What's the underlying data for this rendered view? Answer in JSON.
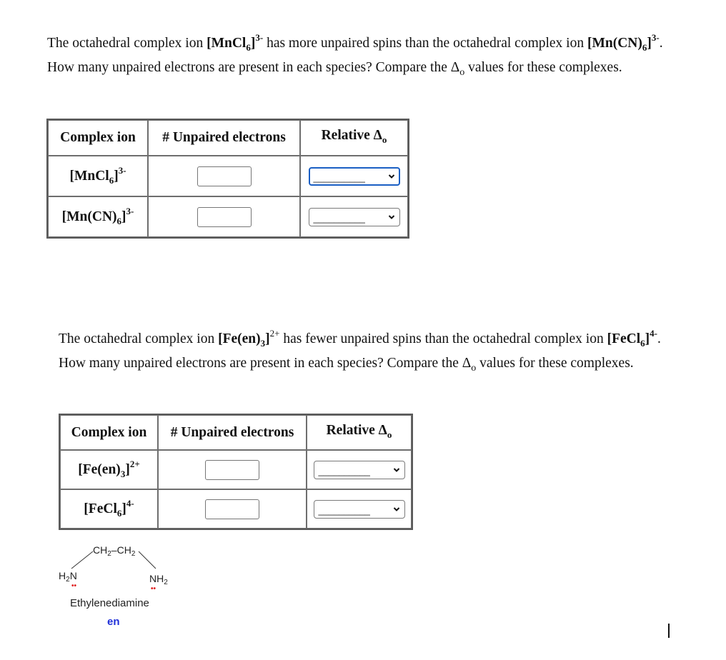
{
  "questions": [
    {
      "prompt": {
        "part1": "The octahedral complex ion ",
        "ion1": "[MnCl",
        "ion1_sub": "6",
        "ion1_close": "]",
        "ion1_charge": "3-",
        "part2": " has more unpaired spins than the octahedral complex ion ",
        "ion2": "[Mn(CN)",
        "ion2_sub": "6",
        "ion2_close": "]",
        "ion2_charge": "3-",
        "part3": ". How many unpaired electrons are present in each species? Compare the ",
        "delta": "Δ",
        "delta_sub": "o",
        "part4": " values for these complexes."
      },
      "table": {
        "headers": {
          "complex_ion": "Complex ion",
          "unpaired": "# Unpaired electrons",
          "relative": "Relative Δ",
          "relative_sub": "o"
        },
        "rows": [
          {
            "ion": "[MnCl",
            "sub": "6",
            "close": "]",
            "charge": "3-",
            "unpaired_value": "",
            "relative_value": "__________",
            "focused": true
          },
          {
            "ion": "[Mn(CN)",
            "sub": "6",
            "close": "]",
            "charge": "3-",
            "unpaired_value": "",
            "relative_value": "__________",
            "focused": false
          }
        ]
      }
    },
    {
      "prompt": {
        "part1": "The octahedral complex ion ",
        "ion1": "[Fe(en)",
        "ion1_sub": "3",
        "ion1_close": "]",
        "ion1_charge": "2+",
        "part2": " has fewer unpaired spins than the octahedral complex ion ",
        "ion2": "[FeCl",
        "ion2_sub": "6",
        "ion2_close": "]",
        "ion2_charge": "4-",
        "part3": ". How many unpaired electrons are present in each species? Compare the ",
        "delta": "Δ",
        "delta_sub": "o",
        "part4": " values for these complexes."
      },
      "table": {
        "headers": {
          "complex_ion": "Complex ion",
          "unpaired": "# Unpaired electrons",
          "relative": "Relative Δ",
          "relative_sub": "o"
        },
        "rows": [
          {
            "ion": "[Fe(en)",
            "sub": "3",
            "close": "]",
            "charge": "2+",
            "unpaired_value": "",
            "relative_value": "__________",
            "focused": false
          },
          {
            "ion": "[FeCl",
            "sub": "6",
            "close": "]",
            "charge": "4-",
            "unpaired_value": "",
            "relative_value": "__________",
            "focused": false
          }
        ]
      }
    }
  ],
  "ligand_figure": {
    "top_chain": "CH",
    "top_chain_sub": "2",
    "bond": "–",
    "top_chain2": "CH",
    "top_chain2_sub": "2",
    "left_amine_h": "H",
    "left_amine_sub": "2",
    "left_amine_n": "N",
    "right_amine_n": "NH",
    "right_amine_sub": "2",
    "lone_pair": "••",
    "name": "Ethylenediamine",
    "abbreviation": "en",
    "lone_pair_color": "#e02020",
    "abbreviation_color": "#1f2fd8"
  },
  "colors": {
    "focus_ring": "#1a5fc4",
    "table_border": "#5a5a5a"
  }
}
